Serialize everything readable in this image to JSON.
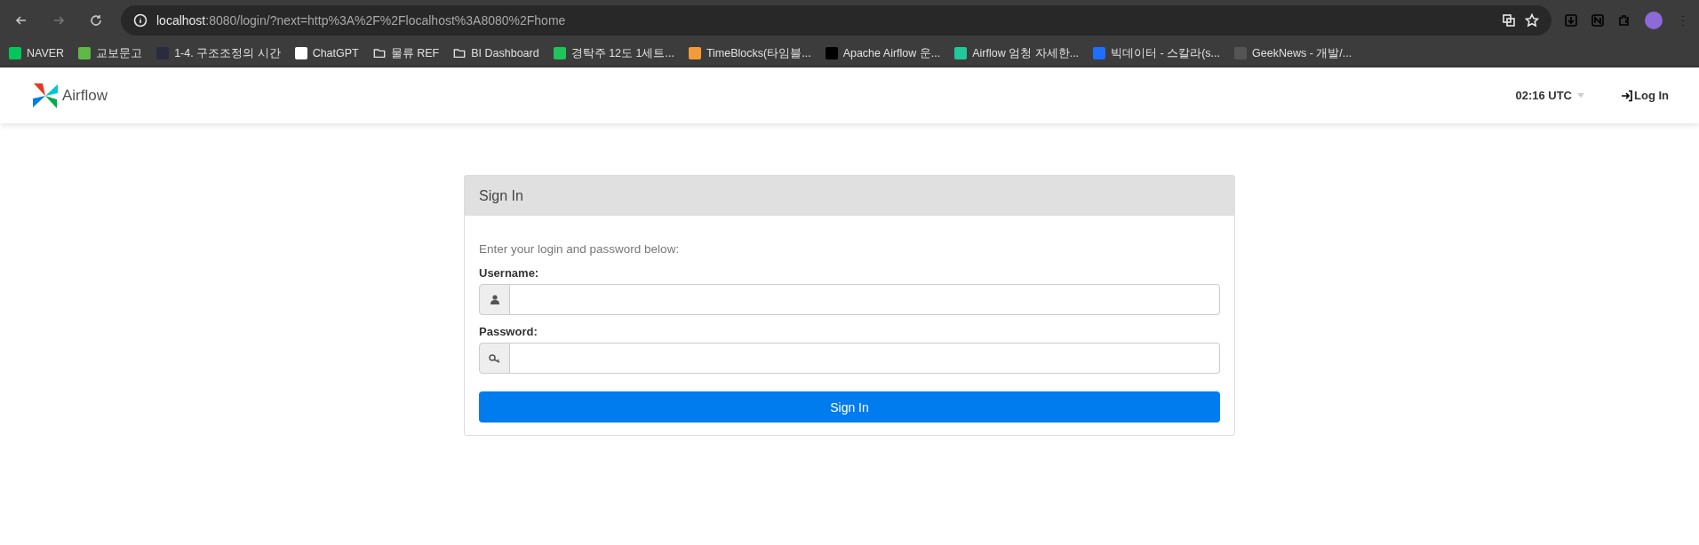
{
  "browser": {
    "url_host": "localhost",
    "url_rest": ":8080/login/?next=http%3A%2F%2Flocalhost%3A8080%2Fhome"
  },
  "bookmarks": [
    {
      "label": "NAVER",
      "kind": "site",
      "color": "#03c75a"
    },
    {
      "label": "교보문고",
      "kind": "site",
      "color": "#5fb847"
    },
    {
      "label": "1-4. 구조조정의 시간",
      "kind": "site",
      "color": "#2b2b40"
    },
    {
      "label": "ChatGPT",
      "kind": "site",
      "color": "#ffffff"
    },
    {
      "label": "물류 REF",
      "kind": "folder"
    },
    {
      "label": "BI Dashboard",
      "kind": "folder"
    },
    {
      "label": "경탁주 12도 1세트...",
      "kind": "site",
      "color": "#21c35c"
    },
    {
      "label": "TimeBlocks(타임블...",
      "kind": "site",
      "color": "#f29b38"
    },
    {
      "label": "Apache Airflow 운...",
      "kind": "site",
      "color": "#000000"
    },
    {
      "label": "Airflow 엄청 자세한...",
      "kind": "site",
      "color": "#20c997"
    },
    {
      "label": "빅데이터 - 스칼라(s...",
      "kind": "site",
      "color": "#1e6fff"
    },
    {
      "label": "GeekNews - 개발/...",
      "kind": "site",
      "color": "#555555"
    }
  ],
  "navbar": {
    "brand": "Airflow",
    "clock": "02:16 UTC",
    "login": "Log In"
  },
  "signin": {
    "title": "Sign In",
    "description": "Enter your login and password below:",
    "fields": [
      {
        "label": "Username:",
        "kind": "user"
      },
      {
        "label": "Password:",
        "kind": "key"
      }
    ],
    "button": "Sign In"
  }
}
